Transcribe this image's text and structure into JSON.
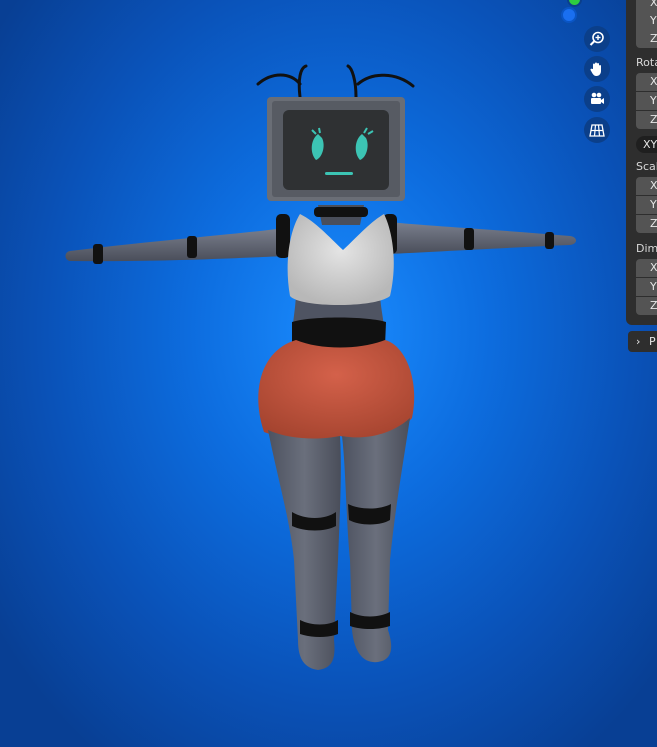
{
  "viewport": {
    "background_color": "#0d6ddf",
    "gizmo": {
      "y_axis_color": "#2ecc40",
      "z_axis_color": "#1a6ff0"
    },
    "nav_buttons": [
      {
        "icon": "zoom-icon"
      },
      {
        "icon": "hand-pan-icon"
      },
      {
        "icon": "camera-icon"
      },
      {
        "icon": "grid-icon"
      }
    ]
  },
  "npanel": {
    "location": {
      "x": "X",
      "y": "Y",
      "z": "Z"
    },
    "rotation": {
      "label": "Rota",
      "x": "X",
      "y": "Y",
      "z": "Z"
    },
    "rotation_mode": "XY",
    "scale": {
      "label": "Scal",
      "x": "X",
      "y": "Y",
      "z": "Z"
    },
    "dimensions": {
      "label": "Dime",
      "x": "X",
      "y": "Y",
      "z": "Z"
    },
    "properties_label": "P"
  },
  "model": {
    "screen_color": "#2f3133",
    "eye_color": "#3cc4b4",
    "body_color": "#5c6170",
    "top_color": "#d8d8d8",
    "shorts_color": "#c0533e",
    "band_color": "#111111"
  }
}
